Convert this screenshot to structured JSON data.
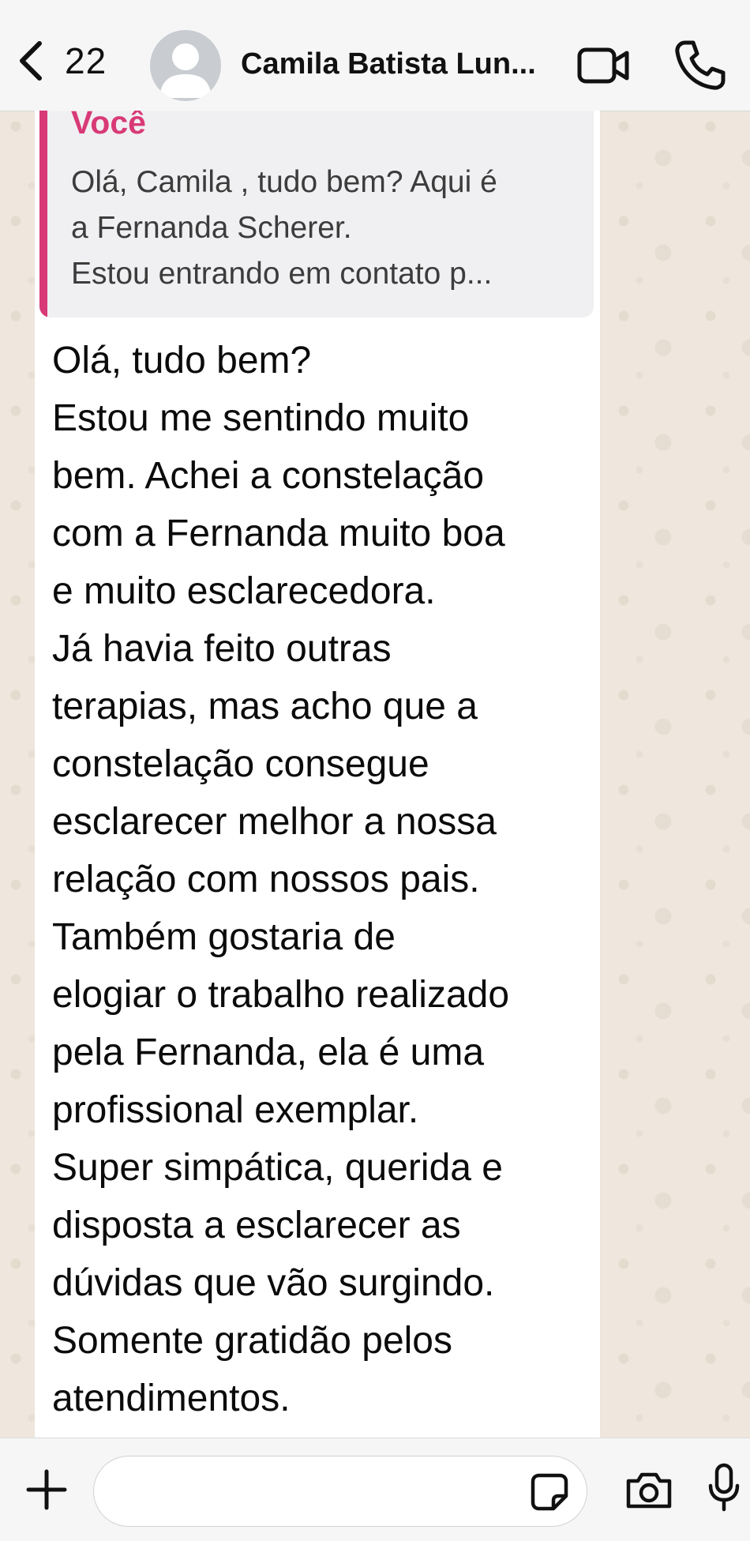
{
  "header": {
    "back_count": "22",
    "contact_name": "Camila Batista Lun..."
  },
  "quoted_message": {
    "author": "Você",
    "lines": [
      "Olá, Camila , tudo bem? Aqui é",
      "a Fernanda Scherer.",
      "Estou entrando em contato p..."
    ]
  },
  "message": {
    "lines": [
      "Olá, tudo bem?",
      "Estou me sentindo muito",
      "bem. Achei a constelação",
      "com a Fernanda muito boa",
      "e muito esclarecedora.",
      "Já havia feito outras",
      "terapias, mas acho que a",
      "constelação consegue",
      "esclarecer melhor a nossa",
      "relação com nossos pais.",
      "Também gostaria de",
      "elogiar o trabalho realizado",
      "pela Fernanda, ela é uma",
      "profissional exemplar.",
      "Super simpática, querida e",
      "disposta a esclarecer as",
      "dúvidas que vão surgindo.",
      "Somente gratidão pelos",
      "atendimentos."
    ]
  },
  "input": {
    "placeholder": ""
  },
  "colors": {
    "quote_accent": "#d83a77",
    "wallpaper": "#efe7dd",
    "bubble": "#ffffff"
  },
  "icons": [
    "chevron-left-icon",
    "avatar-icon",
    "video-call-icon",
    "phone-icon",
    "plus-icon",
    "sticker-icon",
    "camera-icon",
    "microphone-icon"
  ]
}
